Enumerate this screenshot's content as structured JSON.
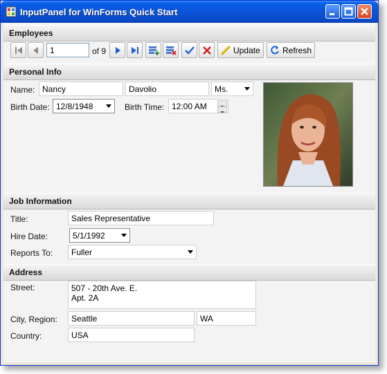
{
  "window": {
    "title": "InputPanel for WinForms Quick Start"
  },
  "employees": {
    "header": "Employees",
    "record_position": "1",
    "record_count": "of 9",
    "update_label": "Update",
    "refresh_label": "Refresh"
  },
  "personal": {
    "header": "Personal Info",
    "name_label": "Name:",
    "first_name": "Nancy",
    "last_name": "Davolio",
    "title_of_courtesy": "Ms.",
    "birth_date_label": "Birth Date:",
    "birth_date": "12/8/1948",
    "birth_time_label": "Birth Time:",
    "birth_time": "12:00 AM"
  },
  "job": {
    "header": "Job Information",
    "title_label": "Title:",
    "title": "Sales Representative",
    "hire_date_label": "Hire Date:",
    "hire_date": "5/1/1992",
    "reports_to_label": "Reports To:",
    "reports_to": "Fuller"
  },
  "address": {
    "header": "Address",
    "street_label": "Street:",
    "street_line1": "507 - 20th Ave. E.",
    "street_line2": "Apt. 2A",
    "city_region_label": "City, Region:",
    "city": "Seattle",
    "region": "WA",
    "country_label": "Country:",
    "country": "USA"
  },
  "colors": {
    "titlebar": "#0a54d8",
    "close_button": "#d9431d",
    "section_header": "#e2e2e2"
  },
  "icons": [
    "app-icon",
    "minimize-icon",
    "maximize-icon",
    "close-icon",
    "first-record-icon",
    "previous-record-icon",
    "next-record-icon",
    "last-record-icon",
    "add-record-icon",
    "delete-record-icon",
    "apply-icon",
    "cancel-icon",
    "update-icon",
    "refresh-icon",
    "chevron-down-icon"
  ]
}
